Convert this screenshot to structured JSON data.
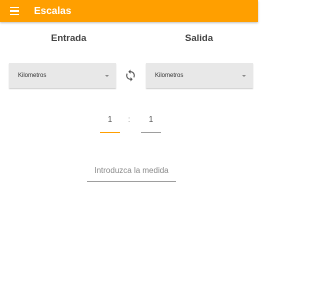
{
  "app": {
    "title": "Escalas"
  },
  "headings": {
    "input": "Entrada",
    "output": "Salida"
  },
  "units": {
    "input_selected": "Kilometros",
    "output_selected": "Kilometros"
  },
  "ratio": {
    "left": "1",
    "separator": ":",
    "right": "1"
  },
  "measure": {
    "placeholder": "Introduzca la medida",
    "value": ""
  },
  "colors": {
    "accent": "#ff9f00",
    "appbar_text": "#ffffff",
    "dropdown_bg": "#e8e8e8"
  },
  "icons": {
    "menu": "menu-icon",
    "swap": "swap-icon",
    "dropdown": "chevron-down-icon"
  }
}
